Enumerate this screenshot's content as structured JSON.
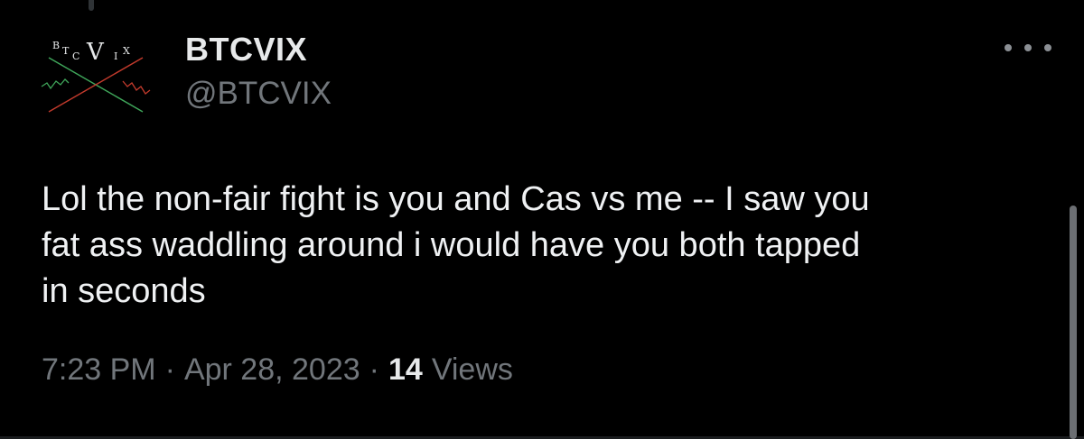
{
  "tweet": {
    "author": {
      "display_name": "BTCVIX",
      "handle": "@BTCVIX",
      "avatar_logo_text": "BTCVIX"
    },
    "more_icon": "more-horizontal-icon",
    "text": "Lol the non-fair fight is you and Cas vs me -- I saw you\nfat ass waddling around i would have you both tapped\nin seconds",
    "time": "7:23 PM",
    "separator": "·",
    "date": "Apr 28, 2023",
    "views_count": "14",
    "views_label": "Views"
  },
  "colors": {
    "background": "#000000",
    "primary_text": "#e7e9ea",
    "secondary_text": "#71767b",
    "logo_green": "#3fa65a",
    "logo_red": "#c23a2c"
  }
}
